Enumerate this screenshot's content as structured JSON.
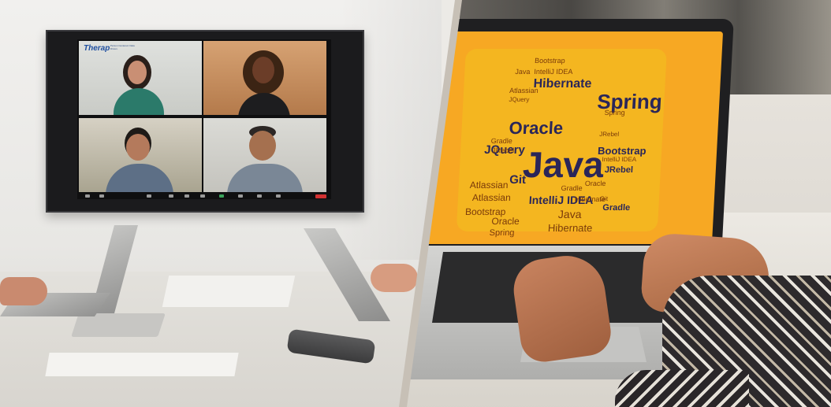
{
  "left_scene": {
    "tv_brand_logo": "Therap",
    "tv_brand_tagline": "Person Centered. Data Driven.",
    "colors": {
      "end_button": "#d13131",
      "brand": "#1f4fa0"
    }
  },
  "right_scene": {
    "screen_color": "#f7a823",
    "word_cloud": [
      "Bootstrap",
      "Java",
      "IntelliJ IDEA",
      "Oracle",
      "Hibernate",
      "Spring",
      "Atlassian",
      "JQuery",
      "Gradle",
      "Git",
      "JRebel",
      "Bootstrap",
      "Java",
      "JQuery",
      "Git",
      "JRebel",
      "IntelliJ IDEA",
      "Atlassian",
      "Gradle",
      "Bootstrap",
      "Oracle",
      "Hibernate",
      "Spring",
      "JRebel",
      "IntelliJ IDEA",
      "Atlassian",
      "Java",
      "Gradle",
      "Oracle",
      "Hibernate",
      "Spring"
    ]
  }
}
